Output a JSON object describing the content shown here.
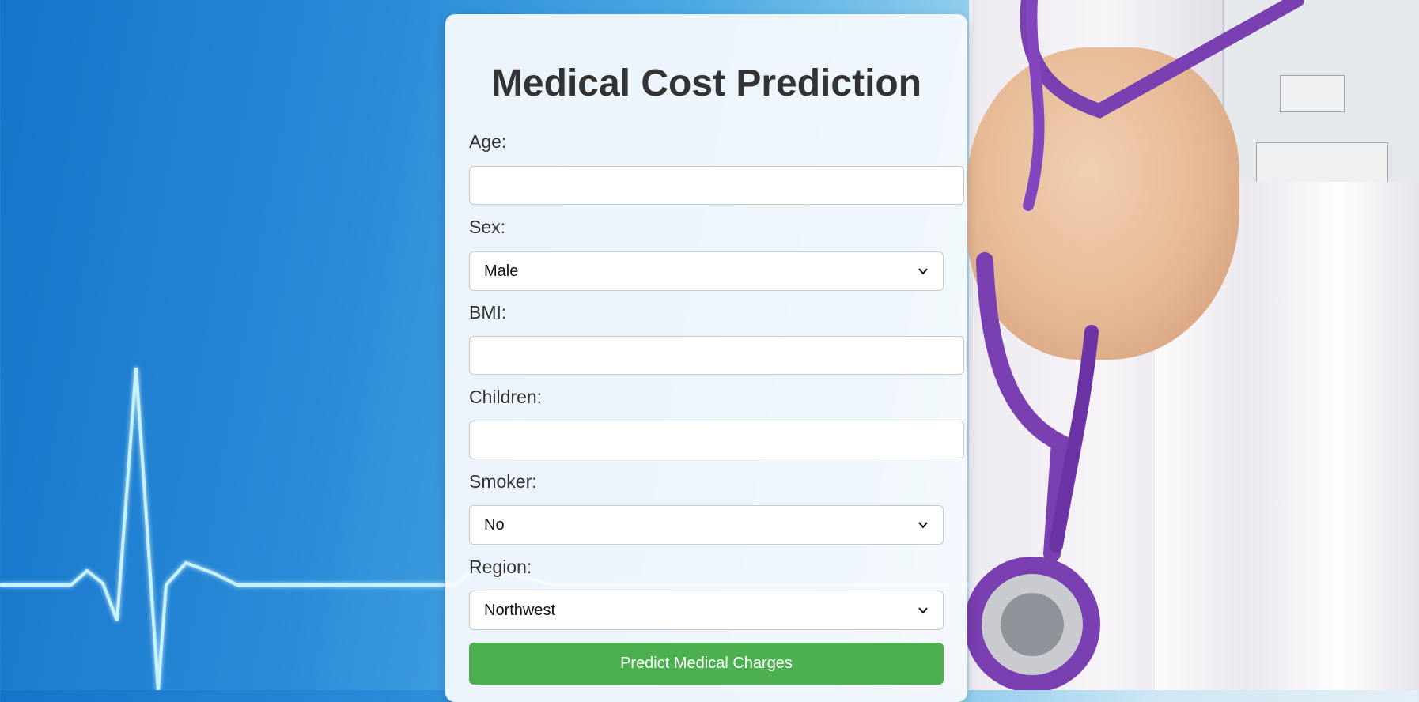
{
  "form": {
    "title": "Medical Cost Prediction",
    "fields": {
      "age": {
        "label": "Age:",
        "value": ""
      },
      "sex": {
        "label": "Sex:",
        "selected": "Male"
      },
      "bmi": {
        "label": "BMI:",
        "value": ""
      },
      "children": {
        "label": "Children:",
        "value": ""
      },
      "smoker": {
        "label": "Smoker:",
        "selected": "No"
      },
      "region": {
        "label": "Region:",
        "selected": "Northwest"
      }
    },
    "submit_label": "Predict Medical Charges"
  },
  "icons": {
    "dropdown": "chevron-down-icon",
    "background": "heartbeat-line-illustration"
  },
  "colors": {
    "submit_button": "#4caf50",
    "background_blue": "#1f80d0",
    "stethoscope_purple": "#7a3fb0"
  }
}
